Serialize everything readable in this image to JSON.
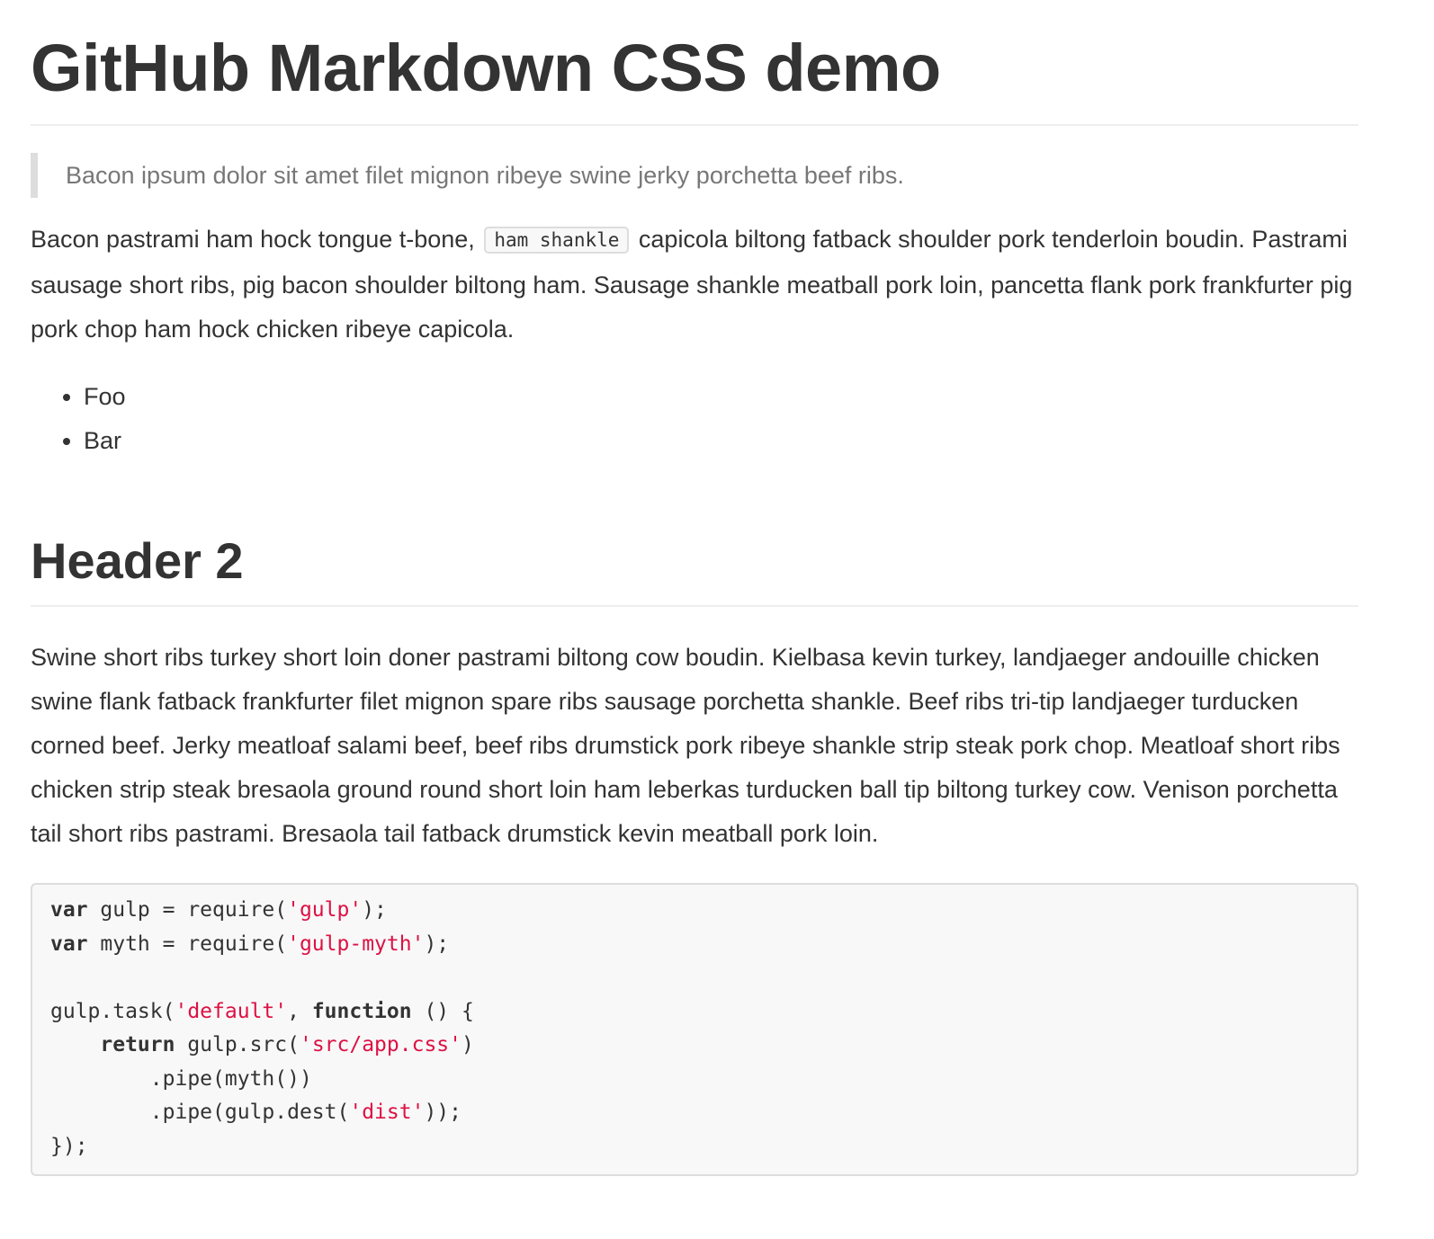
{
  "title": "GitHub Markdown CSS demo",
  "blockquote": "Bacon ipsum dolor sit amet filet mignon ribeye swine jerky porchetta beef ribs.",
  "paragraph1": {
    "before_code": "Bacon pastrami ham hock tongue t-bone,",
    "inline_code": "ham shankle",
    "after_code": "capicola biltong fatback shoulder pork tenderloin boudin. Pastrami sausage short ribs, pig bacon shoulder biltong ham. Sausage shankle meatball pork loin, pancetta flank pork frankfurter pig pork chop ham hock chicken ribeye capicola."
  },
  "list_items": [
    "Foo",
    "Bar"
  ],
  "header2": "Header 2",
  "paragraph2": "Swine short ribs turkey short loin doner pastrami biltong cow boudin. Kielbasa kevin turkey, landjaeger andouille chicken swine flank fatback frankfurter filet mignon spare ribs sausage porchetta shankle. Beef ribs tri-tip landjaeger turducken corned beef. Jerky meatloaf salami beef, beef ribs drumstick pork ribeye shankle strip steak pork chop. Meatloaf short ribs chicken strip steak bresaola ground round short loin ham leberkas turducken ball tip biltong turkey cow. Venison porchetta tail short ribs pastrami. Bresaola tail fatback drumstick kevin meatball pork loin.",
  "code": {
    "line1": {
      "kw": "var",
      "mid": " gulp = require(",
      "str": "'gulp'",
      "end": ");"
    },
    "line2": {
      "kw": "var",
      "mid": " myth = require(",
      "str": "'gulp-myth'",
      "end": ");"
    },
    "line4": {
      "pre": "gulp.task(",
      "str": "'default'",
      "mid": ", ",
      "kw": "function",
      "end": " () {"
    },
    "line5": {
      "indent": "    ",
      "kw": "return",
      "mid": " gulp.src(",
      "str": "'src/app.css'",
      "end": ")"
    },
    "line6": "        .pipe(myth())",
    "line7": {
      "pre": "        .pipe(gulp.dest(",
      "str": "'dist'",
      "end": "));"
    },
    "line8": "});"
  },
  "colors": {
    "text": "#333333",
    "muted": "#777777",
    "code_string": "#dd1144",
    "code_background": "#f8f8f8",
    "border": "#dddddd"
  }
}
